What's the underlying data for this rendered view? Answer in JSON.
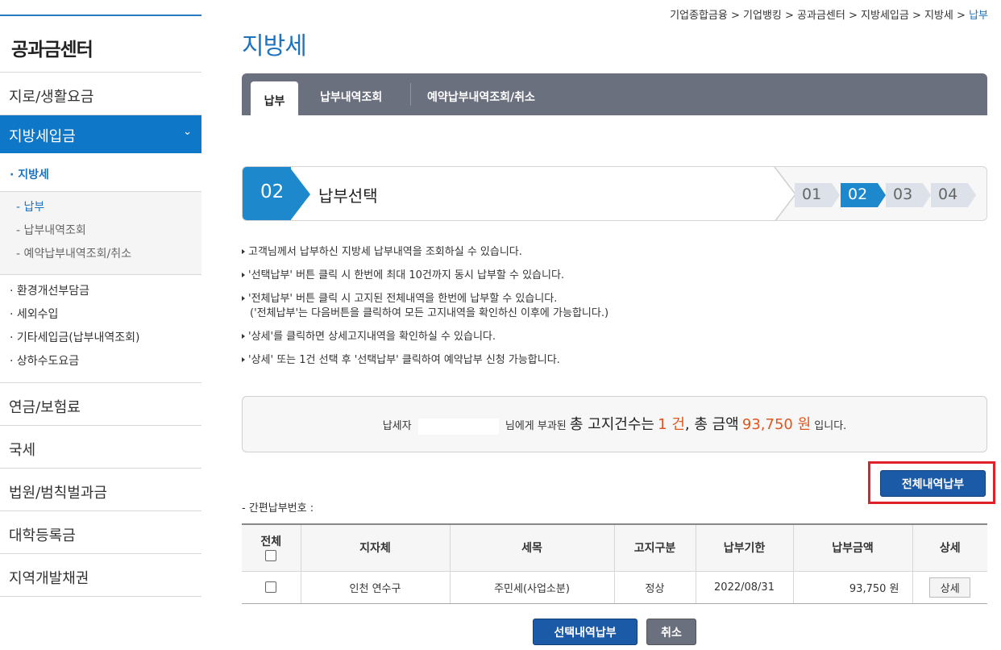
{
  "breadcrumb": {
    "items": [
      "기업종합금융",
      "기업뱅킹",
      "공과금센터",
      "지방세입금",
      "지방세"
    ],
    "current": "납부"
  },
  "sidebar": {
    "title": "공과금센터",
    "items": [
      {
        "label": "지로/생활요금"
      },
      {
        "label": "지방세입금"
      },
      {
        "label": "연금/보험료"
      },
      {
        "label": "국세"
      },
      {
        "label": "법원/범칙벌과금"
      },
      {
        "label": "대학등록금"
      },
      {
        "label": "지역개발채권"
      }
    ],
    "sub1": "· 지방세",
    "sub2": [
      "- 납부",
      "- 납부내역조회",
      "- 예약납부내역조회/취소"
    ],
    "sub3": [
      "· 환경개선부담금",
      "· 세외수입",
      "· 기타세입금(납부내역조회)",
      "· 상하수도요금"
    ]
  },
  "page": {
    "title": "지방세"
  },
  "tabs": [
    "납부",
    "납부내역조회",
    "예약납부내역조회/취소"
  ],
  "step": {
    "badge": "02",
    "title": "납부선택",
    "chips": [
      "01",
      "02",
      "03",
      "04"
    ],
    "active": 1
  },
  "notes": [
    "고객님께서 납부하신 지방세 납부내역을 조회하실 수 있습니다.",
    "'선택납부' 버튼 클릭 시 한번에 최대 10건까지 동시 납부할 수 있습니다.",
    "'전체납부' 버튼 클릭 시 고지된 전체내역을 한번에 납부할 수 있습니다.",
    "('전체납부'는 다음버튼을 클릭하여 모든 고지내역을 확인하신 이후에 가능합니다.)",
    "'상세'를 클릭하면 상세고지내역을 확인하실 수 있습니다.",
    "'상세' 또는 1건 선택 후 '선택납부' 클릭하여 예약납부 신청 가능합니다."
  ],
  "summary": {
    "prefix": "납세자",
    "mid": "님에게 부과된",
    "count_label": "총 고지건수는",
    "count": "1 건",
    "amount_label": ", 총 금액",
    "amount": "93,750 원",
    "suffix": "입니다."
  },
  "buttons": {
    "pay_all": "전체내역납부",
    "pay_selected": "선택내역납부",
    "cancel": "취소"
  },
  "easy_label": "- 간편납부번호 :",
  "table": {
    "headers": [
      "전체",
      "지자체",
      "세목",
      "고지구분",
      "납부기한",
      "납부금액",
      "상세"
    ],
    "rows": [
      {
        "region": "인천 연수구",
        "tax": "주민세(사업소분)",
        "type": "정상",
        "due": "2022/08/31",
        "amount": "93,750 원",
        "detail": "상세"
      }
    ]
  }
}
